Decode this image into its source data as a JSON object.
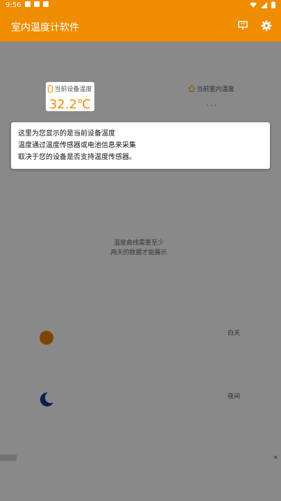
{
  "status_bar": {
    "time": "9:56"
  },
  "app_bar": {
    "title": "室内温度计软件",
    "icons": [
      "notes-icon",
      "gear-icon"
    ]
  },
  "cards": {
    "device": {
      "label": "当前设备温度",
      "value": "32.2℃"
    },
    "room": {
      "label": "当前室内温度",
      "value": "···"
    }
  },
  "chart_hint": {
    "line1": "温度曲线需要至少",
    "line2": "两天的数据才能展示"
  },
  "legend": {
    "day": "白天",
    "night": "夜间"
  },
  "tooltip": {
    "line1": "这里为您显示的是当前设备温度",
    "line2": "温度通过温度传感器或电池信息来采集",
    "line3": "取决于您的设备是否支持温度传感器。"
  },
  "colors": {
    "accent": "#f08c00",
    "moon": "#1a3a8a",
    "sun": "#e37d00"
  },
  "ad": {
    "close": "×"
  }
}
